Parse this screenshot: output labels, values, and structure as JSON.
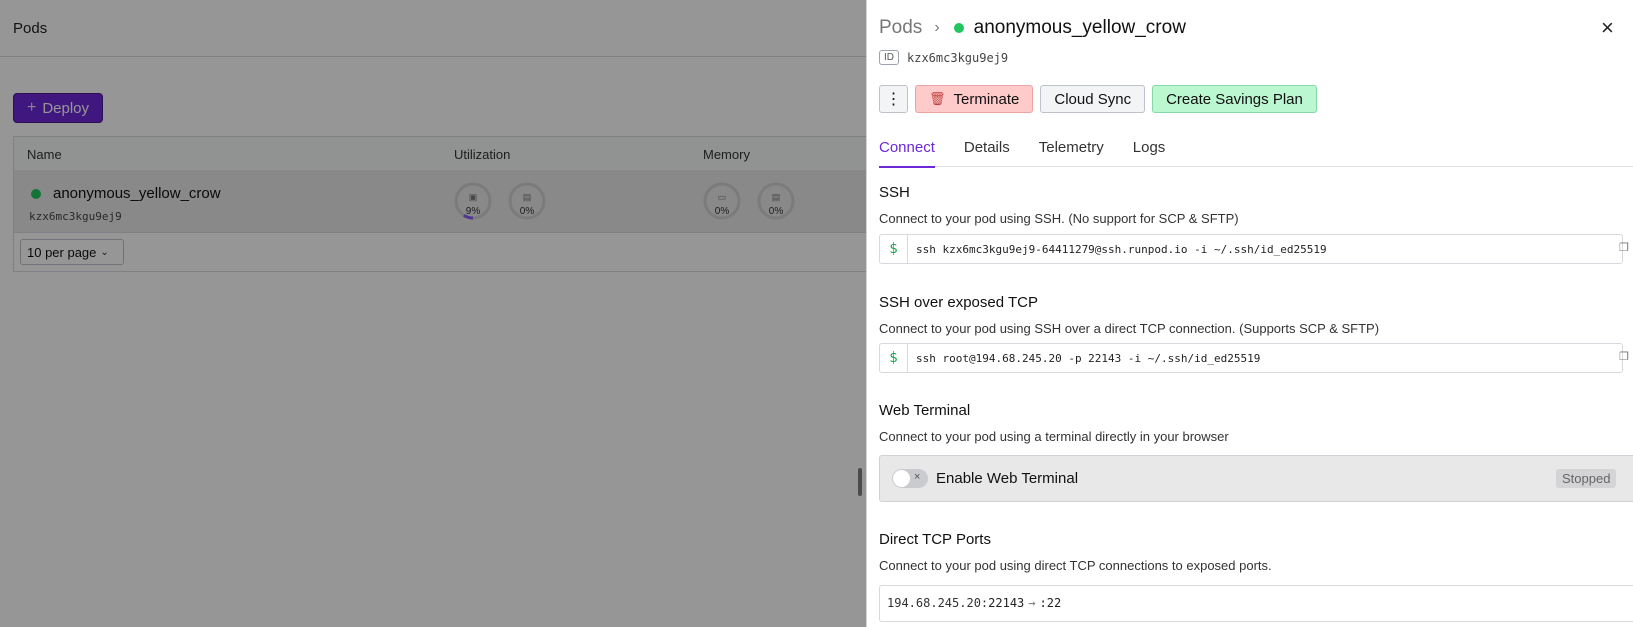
{
  "app": {
    "title": "Pods",
    "deploy_label": "Deploy",
    "table": {
      "columns": [
        "Name",
        "Utilization",
        "Memory"
      ],
      "row": {
        "name": "anonymous_yellow_crow",
        "id": "kzx6mc3kgu9ej9",
        "utilization": [
          {
            "icon": "cpu-icon",
            "percent": "9%",
            "fraction": 0.09
          },
          {
            "icon": "gpu-icon",
            "percent": "0%",
            "fraction": 0
          }
        ],
        "memory": [
          {
            "icon": "memory-icon",
            "percent": "0%",
            "fraction": 0
          },
          {
            "icon": "vram-icon",
            "percent": "0%",
            "fraction": 0
          }
        ]
      },
      "per_page": "10 per page"
    }
  },
  "drawer": {
    "breadcrumb_parent": "Pods",
    "pod_name": "anonymous_yellow_crow",
    "status_color": "#22c55e",
    "id_badge": "ID",
    "pod_id": "kzx6mc3kgu9ej9",
    "actions": {
      "more": "⋮",
      "terminate": "Terminate",
      "cloud_sync": "Cloud Sync",
      "savings_plan": "Create Savings Plan"
    },
    "tabs": [
      "Connect",
      "Details",
      "Telemetry",
      "Logs"
    ],
    "active_tab": "Connect",
    "ssh": {
      "title": "SSH",
      "description": "Connect to your pod using SSH. (No support for SCP & SFTP)",
      "prompt": "$",
      "command": "ssh kzx6mc3kgu9ej9-64411279@ssh.runpod.io -i ~/.ssh/id_ed25519"
    },
    "ssh_tcp": {
      "title": "SSH over exposed TCP",
      "description": "Connect to your pod using SSH over a direct TCP connection. (Supports SCP & SFTP)",
      "prompt": "$",
      "command": "ssh root@194.68.245.20 -p 22143 -i ~/.ssh/id_ed25519"
    },
    "web_terminal": {
      "title": "Web Terminal",
      "description": "Connect to your pod using a terminal directly in your browser",
      "toggle_label": "Enable Web Terminal",
      "status": "Stopped"
    },
    "tcp_ports": {
      "title": "Direct TCP Ports",
      "description": "Connect to your pod using direct TCP connections to exposed ports.",
      "ip": "194.68.245.20:",
      "public_port": "22143",
      "arrow": "→",
      "internal_port": ":22"
    }
  },
  "colors": {
    "accent": "#6d28d9",
    "running": "#22c55e",
    "terminate_bg": "#fecaca",
    "savings_bg": "#bbf7d0"
  }
}
